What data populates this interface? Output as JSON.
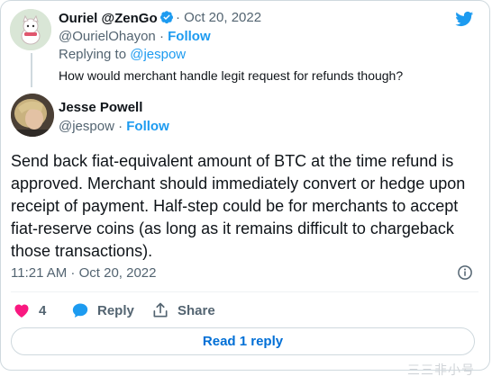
{
  "parent_tweet": {
    "display_name": "Ouriel @ZenGo",
    "handle": "@OurielOhayon",
    "timestamp": "Oct 20, 2022",
    "follow_label": "Follow",
    "replying_to_prefix": "Replying to",
    "replying_to_handle": "@jespow",
    "text": "How would merchant handle legit request for refunds though?"
  },
  "main_tweet": {
    "display_name": "Jesse Powell",
    "handle": "@jespow",
    "follow_label": "Follow",
    "text": "Send back fiat-equivalent amount of BTC at the time refund is approved. Merchant should immediately convert or hedge upon receipt of payment. Half-step could be for merchants to accept fiat-reserve coins (as long as it remains difficult to chargeback those transactions).",
    "timestamp": "11:21 AM · Oct 20, 2022"
  },
  "actions": {
    "like_count": "4",
    "reply_label": "Reply",
    "share_label": "Share"
  },
  "read_replies_label": "Read 1 reply",
  "watermark": "三三非小号",
  "colors": {
    "accent": "#1d9bf0",
    "like": "#f91880",
    "text": "#0f1419",
    "muted": "#536471"
  },
  "icons": [
    "twitter-bird-icon",
    "verified-badge-icon",
    "info-icon",
    "heart-icon",
    "reply-bubble-icon",
    "share-icon"
  ]
}
